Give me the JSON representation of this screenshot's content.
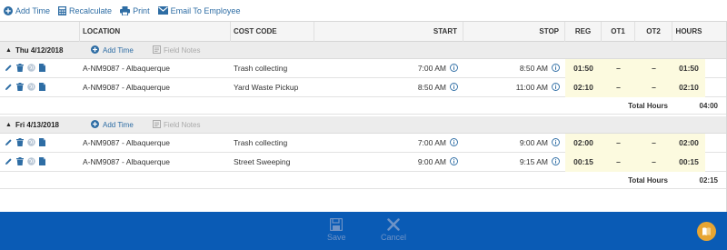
{
  "toolbar": {
    "add_time": "Add Time",
    "recalculate": "Recalculate",
    "print": "Print",
    "email": "Email To Employee"
  },
  "columns": {
    "location": "LOCATION",
    "cost_code": "COST CODE",
    "start": "START",
    "stop": "STOP",
    "reg": "REG",
    "ot1": "OT1",
    "ot2": "OT2",
    "hours": "HOURS"
  },
  "groups": [
    {
      "date": "Thu 4/12/2018",
      "add_time": "Add Time",
      "field_notes": "Field Notes",
      "rows": [
        {
          "location": "A-NM9087 - Albaquerque",
          "cost_code": "Trash collecting",
          "start": "7:00 AM",
          "stop": "8:50 AM",
          "reg": "01:50",
          "ot1": "–",
          "ot2": "–",
          "hours": "01:50"
        },
        {
          "location": "A-NM9087 - Albaquerque",
          "cost_code": "Yard Waste Pickup",
          "start": "8:50 AM",
          "stop": "11:00 AM",
          "reg": "02:10",
          "ot1": "–",
          "ot2": "–",
          "hours": "02:10"
        }
      ],
      "total_label": "Total Hours",
      "total_value": "04:00"
    },
    {
      "date": "Fri 4/13/2018",
      "add_time": "Add Time",
      "field_notes": "Field Notes",
      "rows": [
        {
          "location": "A-NM9087 - Albaquerque",
          "cost_code": "Trash collecting",
          "start": "7:00 AM",
          "stop": "9:00 AM",
          "reg": "02:00",
          "ot1": "–",
          "ot2": "–",
          "hours": "02:00"
        },
        {
          "location": "A-NM9087 - Albaquerque",
          "cost_code": "Street Sweeping",
          "start": "9:00 AM",
          "stop": "9:15 AM",
          "reg": "00:15",
          "ot1": "–",
          "ot2": "–",
          "hours": "00:15"
        }
      ],
      "total_label": "Total Hours",
      "total_value": "02:15"
    }
  ],
  "footer": {
    "save": "Save",
    "cancel": "Cancel"
  },
  "colors": {
    "accent": "#2e6da4",
    "footer_bg": "#0a5bb5",
    "highlight": "#fcfadf",
    "help": "#e7a533"
  },
  "icons": {
    "row_actions": [
      "pencil-icon",
      "trash-icon",
      "globe-icon",
      "document-icon"
    ],
    "info": "info-icon"
  }
}
